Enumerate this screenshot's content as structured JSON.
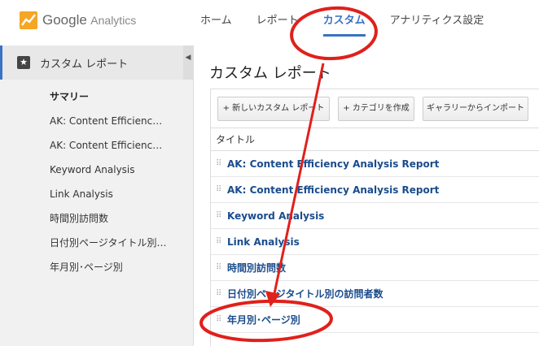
{
  "app": {
    "brand_google": "Google",
    "brand_product": "Analytics"
  },
  "nav": {
    "tabs": [
      {
        "label": "ホーム"
      },
      {
        "label": "レポート"
      },
      {
        "label": "カスタム",
        "active": true
      },
      {
        "label": "アナリティクス設定"
      }
    ]
  },
  "sidebar": {
    "header": "カスタム レポート",
    "collapse_glyph": "◀",
    "items": [
      {
        "label": "サマリー",
        "active": true
      },
      {
        "label": "AK: Content Efficiency Analysis Report"
      },
      {
        "label": "AK: Content Efficiency Analysis Report"
      },
      {
        "label": "Keyword Analysis"
      },
      {
        "label": "Link Analysis"
      },
      {
        "label": "時間別訪問数"
      },
      {
        "label": "日付別ページタイトル別の訪問者数"
      },
      {
        "label": "年月別･ページ別"
      }
    ]
  },
  "main": {
    "title": "カスタム レポート",
    "toolbar": {
      "new_report": "+ 新しいカスタム レポート",
      "new_category": "+ カテゴリを作成",
      "import_gallery": "ギャラリーからインポート"
    },
    "table": {
      "column_title": "タイトル",
      "rows": [
        "AK: Content Efficiency Analysis Report",
        "AK: Content Efficiency Analysis Report",
        "Keyword Analysis",
        "Link Analysis",
        "時間別訪問数",
        "日付別ページタイトル別の訪問者数",
        "年月別･ページ別"
      ]
    }
  },
  "colors": {
    "accent_blue": "#3a72c4",
    "link_blue": "#1a4c8c",
    "annotation_red": "#e0201c",
    "logo_orange": "#f5a623"
  }
}
